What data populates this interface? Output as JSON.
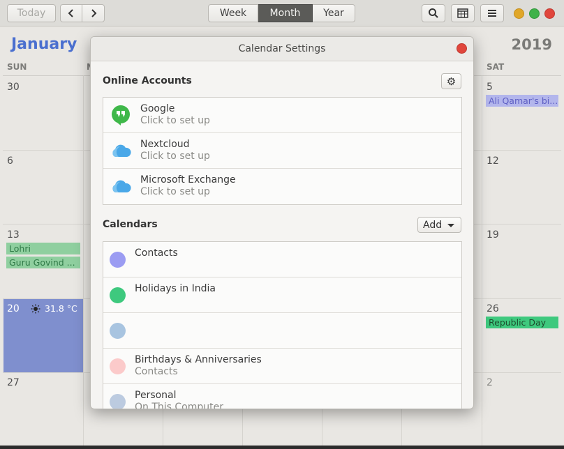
{
  "toolbar": {
    "today_label": "Today",
    "prev_icon": "chevron-left-icon",
    "next_icon": "chevron-right-icon",
    "views": [
      {
        "label": "Week",
        "active": false
      },
      {
        "label": "Month",
        "active": true
      },
      {
        "label": "Year",
        "active": false
      }
    ],
    "search_icon": "search-icon",
    "calendar_icon": "calendar-grid-icon",
    "menu_icon": "hamburger-menu-icon",
    "window_controls": {
      "minimize": "#e0a729",
      "maximize": "#3fb24a",
      "close": "#e0463c"
    }
  },
  "calendar": {
    "month": "January",
    "year": "2019",
    "weekdays_visible": {
      "sun": "SUN",
      "sat": "SAT"
    },
    "days": {
      "r1": {
        "sun": "30",
        "sat": "5"
      },
      "r2": {
        "sun": "6",
        "sat": "12"
      },
      "r3": {
        "sun": "13",
        "sat": "19"
      },
      "r4": {
        "sun": "20",
        "sat": "26"
      },
      "r5": {
        "sun": "27",
        "sat": "2"
      }
    },
    "events": {
      "sat5": "Ali Qamar's bi...",
      "lohri": "Lohri",
      "guru": "Guru Govind ...",
      "republic": "Republic Day"
    },
    "weather": {
      "icon": "sun-icon",
      "temp": "31.8 °C"
    },
    "accent": "#4a6fcf",
    "today_color": "#7f8fce"
  },
  "dialog": {
    "title": "Calendar Settings",
    "online_accounts_title": "Online Accounts",
    "settings_icon": "gear-icon",
    "accounts": [
      {
        "name": "Google",
        "status": "Click to set up",
        "icon": "google-hangouts-icon"
      },
      {
        "name": "Nextcloud",
        "status": "Click to set up",
        "icon": "cloud-icon"
      },
      {
        "name": "Microsoft Exchange",
        "status": "Click to set up",
        "icon": "cloud-icon"
      }
    ],
    "calendars_title": "Calendars",
    "add_label": "Add",
    "calendars": [
      {
        "name": "Contacts",
        "source": "",
        "color": "#9b9cf2"
      },
      {
        "name": "Holidays in India",
        "source": "",
        "color": "#3ec97e"
      },
      {
        "name": "",
        "source": "",
        "color": "#a8c4e0"
      },
      {
        "name": "Birthdays & Anniversaries",
        "source": "Contacts",
        "color": "#fbcaca"
      },
      {
        "name": "Personal",
        "source": "On This Computer",
        "color": "#bccbe0"
      }
    ]
  }
}
